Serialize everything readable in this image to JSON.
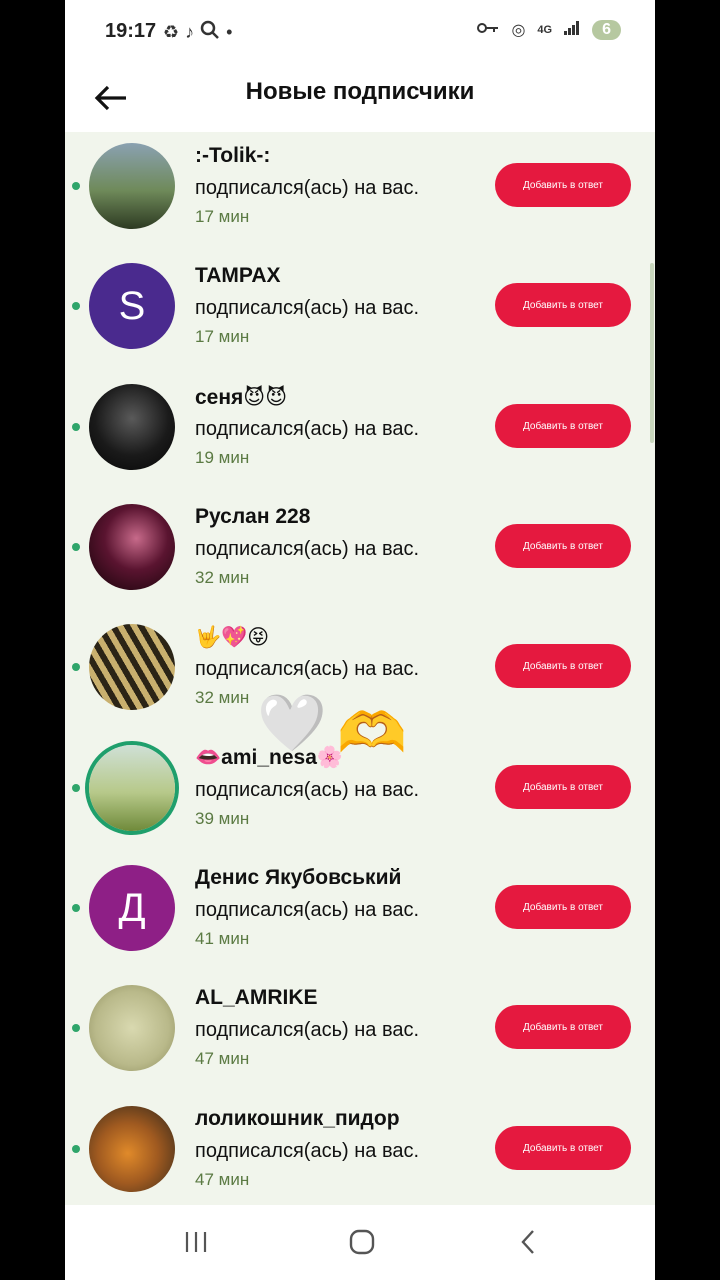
{
  "status_bar": {
    "time": "19:17",
    "left_icons": [
      "recycle-icon",
      "tiktok-icon",
      "search-icon",
      "dot"
    ],
    "network": "4G",
    "battery": "6"
  },
  "header": {
    "title": "Новые подписчики"
  },
  "followers": [
    {
      "name": ":-Tolik-:",
      "action": "подписался(ась) на вас.",
      "time": "17 мин",
      "button": "Добавить в ответ",
      "avatar_letter": ""
    },
    {
      "name": "TAMPAX",
      "action": "подписался(ась) на вас.",
      "time": "17 мин",
      "button": "Добавить в ответ",
      "avatar_letter": "S",
      "avatar_color": "#4a2a8e"
    },
    {
      "name": "сеня😈😈",
      "action": "подписался(ась) на вас.",
      "time": "19 мин",
      "button": "Добавить в ответ",
      "avatar_letter": ""
    },
    {
      "name": "Руслан 228",
      "action": "подписался(ась) на вас.",
      "time": "32 мин",
      "button": "Добавить в ответ",
      "avatar_letter": ""
    },
    {
      "name": "🤟💖😝",
      "action": "подписался(ась) на вас.",
      "time": "32 мин",
      "button": "Добавить в ответ",
      "avatar_letter": ""
    },
    {
      "name": "👄ami_nesa🌸",
      "action": "подписался(ась) на вас.",
      "time": "39 мин",
      "button": "Добавить в ответ",
      "avatar_letter": ""
    },
    {
      "name": "Денис Якубовський",
      "action": "подписался(ась) на вас.",
      "time": "41 мин",
      "button": "Добавить в ответ",
      "avatar_letter": "Д",
      "avatar_color": "#8e1f86"
    },
    {
      "name": "AL_AMRIKE",
      "action": "подписался(ась) на вас.",
      "time": "47 мин",
      "button": "Добавить в ответ",
      "avatar_letter": ""
    },
    {
      "name": "лоликошник_пидор",
      "action": "подписался(ась) на вас.",
      "time": "47 мин",
      "button": "Добавить в ответ",
      "avatar_letter": ""
    }
  ],
  "overlay_emojis": [
    "🤍",
    "🫶"
  ],
  "colors": {
    "accent": "#e5193f",
    "background": "#f1f5ec",
    "time_text": "#5b7a43",
    "online_dot": "#2fa56a"
  }
}
